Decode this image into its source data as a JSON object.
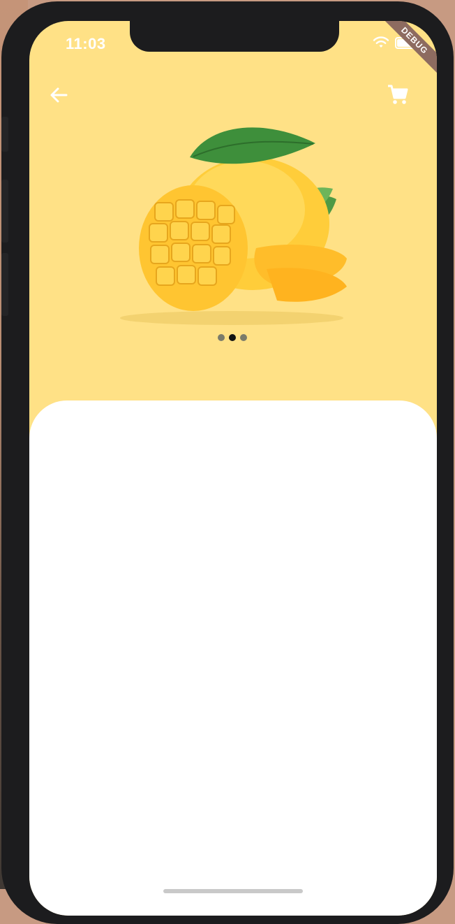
{
  "status_bar": {
    "time": "11:03",
    "debug_label": "DEBUG"
  },
  "app_bar": {
    "back_icon": "arrow-left-icon",
    "cart_icon": "shopping-cart-icon"
  },
  "hero": {
    "image": "mango-image"
  },
  "carousel": {
    "total": 3,
    "active_index": 1
  },
  "colors": {
    "header_bg": "#ffe186",
    "card_bg": "#ffffff",
    "frame": "#1c1c1e"
  }
}
